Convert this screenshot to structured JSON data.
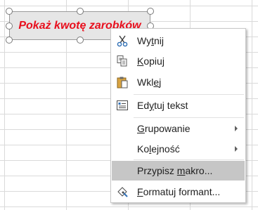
{
  "shape": {
    "text": "Pokaż kwotę zarobków"
  },
  "context_menu": {
    "items": [
      {
        "mnemonic": "Wy",
        "u": "t",
        "rest": "nij",
        "icon": "scissors-icon"
      },
      {
        "mnemonic": "",
        "u": "K",
        "rest": "opiuj",
        "icon": "copy-icon"
      },
      {
        "mnemonic": "Wkl",
        "u": "e",
        "rest": "j",
        "icon": "paste-icon"
      },
      {
        "mnemonic": "Ed",
        "u": "y",
        "rest": "tuj tekst",
        "icon": "edit-text-icon"
      },
      {
        "mnemonic": "",
        "u": "G",
        "rest": "rupowanie",
        "icon": ""
      },
      {
        "mnemonic": "Ko",
        "u": "l",
        "rest": "ejność",
        "icon": ""
      },
      {
        "mnemonic": "Przypisz ",
        "u": "m",
        "rest": "akro...",
        "icon": ""
      },
      {
        "mnemonic": "",
        "u": "F",
        "rest": "ormatuj formant...",
        "icon": "format-control-icon"
      }
    ]
  },
  "colors": {
    "shape_text": "#e8101e",
    "highlight": "#c6c6c6"
  }
}
